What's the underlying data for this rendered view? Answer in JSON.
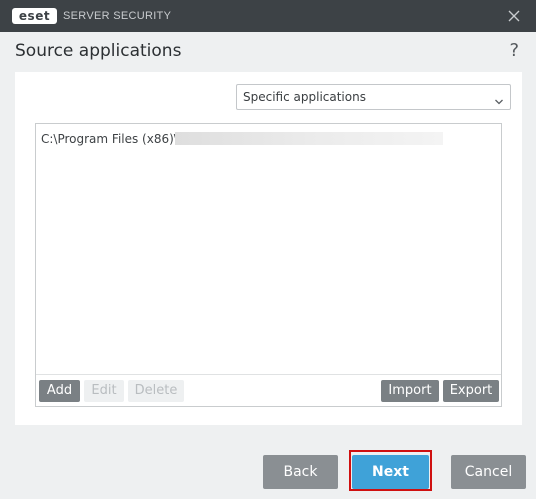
{
  "window": {
    "brand": "eset",
    "product": "SERVER SECURITY",
    "close_icon": "close-icon"
  },
  "header": {
    "title": "Source applications",
    "help": "?"
  },
  "selector": {
    "value": "Specific applications",
    "icon": "chevron-down-icon"
  },
  "list": {
    "items": [
      "C:\\Program Files (x86)\\"
    ]
  },
  "list_toolbar": {
    "add": "Add",
    "edit": "Edit",
    "delete": "Delete",
    "import": "Import",
    "export": "Export"
  },
  "footer": {
    "back": "Back",
    "next": "Next",
    "cancel": "Cancel"
  },
  "colors": {
    "titlebar": "#3d4246",
    "primary": "#3fa2d8",
    "highlight": "#cf1010",
    "button_grey": "#8a8f93"
  }
}
